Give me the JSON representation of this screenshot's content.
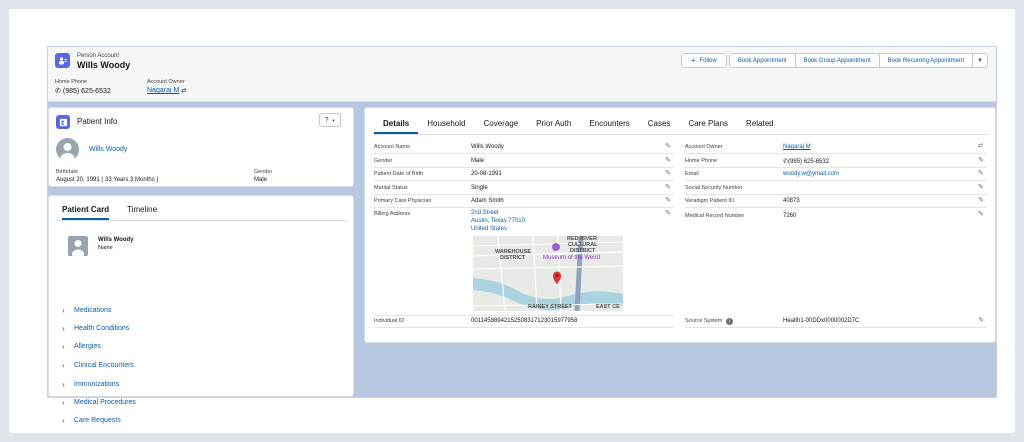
{
  "header": {
    "record_type": "Person Account",
    "record_name": "Wills Woody",
    "buttons": {
      "follow": "Follow",
      "book": "Book Appointment",
      "book_group": "Book Group Appointment",
      "book_recurring": "Book Recurring Appointment"
    },
    "home_phone_label": "Home Phone",
    "home_phone": "(985) 625-6532",
    "owner_label": "Account Owner",
    "owner": "Nagaraj M"
  },
  "patient_info": {
    "title": "Patient Info",
    "help_button": "?",
    "name": "Wills Woody",
    "birthdate_label": "Birthdate",
    "birthdate": "August 20, 1991 ( 33 Years 3 Months )",
    "gender_label": "Gender",
    "gender": "Male"
  },
  "patient_card": {
    "tabs": [
      "Patient Card",
      "Timeline"
    ],
    "name": "Wills Woody",
    "sub": "Name",
    "sections": [
      "Medications",
      "Health Conditions",
      "Allergies",
      "Clinical Encounters",
      "Immunizations",
      "Medical Procedures",
      "Care Requests"
    ]
  },
  "details": {
    "tabs": [
      "Details",
      "Household",
      "Coverage",
      "Prior Auth",
      "Encounters",
      "Cases",
      "Care Plans",
      "Related"
    ],
    "left": [
      {
        "label": "Account Name",
        "value": "Wills Woody"
      },
      {
        "label": "Gender",
        "value": "Male"
      },
      {
        "label": "Patient Date of Birth",
        "value": "20-08-1991"
      },
      {
        "label": "Marital Status",
        "value": "Single"
      },
      {
        "label": "Primary Care Physician",
        "value": "Adam Smith"
      }
    ],
    "billing_label": "Billing Address",
    "billing_street": "2nd Street",
    "billing_city": "Austin, Texas 77010",
    "billing_country": "United States",
    "map_labels": {
      "district1": "WAREHOUSE",
      "district1b": "DISTRICT",
      "district2": "RED RIVER",
      "district2b": "CULTURAL",
      "district2c": "DISTRICT",
      "poi": "Museum of the Weird",
      "street1": "RAINEY STREET",
      "street2": "EAST CE"
    },
    "right": [
      {
        "label": "Account Owner",
        "value": "Nagaraj M"
      },
      {
        "label": "Home Phone",
        "value": "(985) 625-6532"
      },
      {
        "label": "Email",
        "value": "woody.w@ymail.com"
      },
      {
        "label": "Social Security Number",
        "value": ""
      },
      {
        "label": "Veradigm Patient ID",
        "value": "40873"
      },
      {
        "label": "Medical Record Number",
        "value": "7260"
      }
    ],
    "individual_id_label": "Individual ID",
    "individual_id": "00114588942152508317123015977958",
    "source_label": "Source System",
    "source_value": "Health1-00DDx0000002D7C"
  }
}
